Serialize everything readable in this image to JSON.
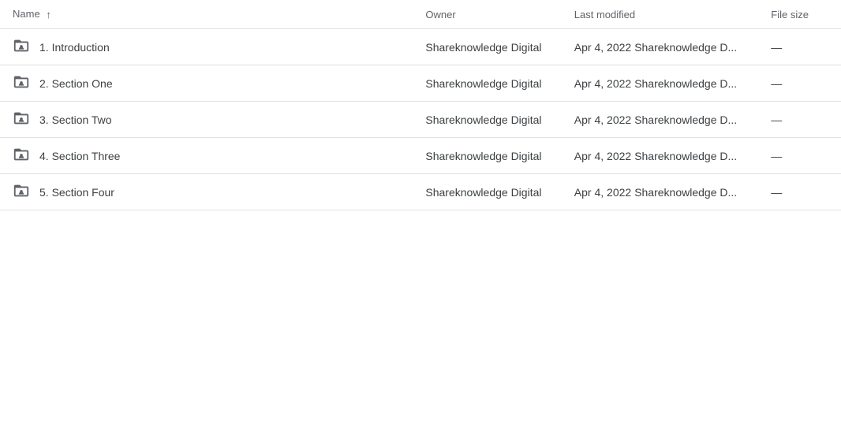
{
  "table": {
    "columns": {
      "name": "Name",
      "owner": "Owner",
      "last_modified": "Last modified",
      "file_size": "File size"
    },
    "sort_icon": "↑",
    "rows": [
      {
        "id": 1,
        "name": "1. Introduction",
        "owner": "Shareknowledge Digital",
        "modified_date": "Apr 4, 2022",
        "modified_by": "Shareknowledge D...",
        "file_size": "—"
      },
      {
        "id": 2,
        "name": "2. Section One",
        "owner": "Shareknowledge Digital",
        "modified_date": "Apr 4, 2022",
        "modified_by": "Shareknowledge D...",
        "file_size": "—"
      },
      {
        "id": 3,
        "name": "3. Section Two",
        "owner": "Shareknowledge Digital",
        "modified_date": "Apr 4, 2022",
        "modified_by": "Shareknowledge D...",
        "file_size": "—"
      },
      {
        "id": 4,
        "name": "4. Section Three",
        "owner": "Shareknowledge Digital",
        "modified_date": "Apr 4, 2022",
        "modified_by": "Shareknowledge D...",
        "file_size": "—"
      },
      {
        "id": 5,
        "name": "5. Section Four",
        "owner": "Shareknowledge Digital",
        "modified_date": "Apr 4, 2022",
        "modified_by": "Shareknowledge D...",
        "file_size": "—"
      }
    ]
  }
}
